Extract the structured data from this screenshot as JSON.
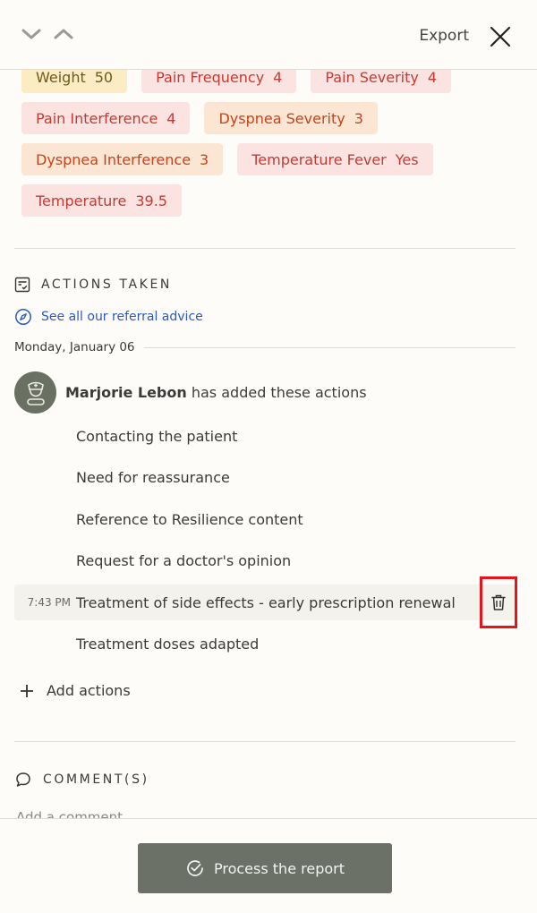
{
  "header": {
    "export_label": "Export"
  },
  "tags": [
    {
      "name": "Weight",
      "value": "50",
      "tone": "yellow"
    },
    {
      "name": "Pain Frequency",
      "value": "4",
      "tone": "pink"
    },
    {
      "name": "Pain Severity",
      "value": "4",
      "tone": "pink"
    },
    {
      "name": "Pain Interference",
      "value": "4",
      "tone": "pink"
    },
    {
      "name": "Dyspnea Severity",
      "value": "3",
      "tone": "peach"
    },
    {
      "name": "Dyspnea Interference",
      "value": "3",
      "tone": "peach"
    },
    {
      "name": "Temperature Fever",
      "value": "Yes",
      "tone": "pink"
    },
    {
      "name": "Temperature",
      "value": "39.5",
      "tone": "pink"
    }
  ],
  "actions_section": {
    "title": "ACTIONS TAKEN",
    "referral_link": "See all our referral advice",
    "date": "Monday, January 06",
    "author_name": "Marjorie Lebon",
    "author_suffix": "has added these actions",
    "items": [
      {
        "label": "Contacting the patient",
        "time": ""
      },
      {
        "label": "Need for reassurance",
        "time": ""
      },
      {
        "label": "Reference to Resilience content",
        "time": ""
      },
      {
        "label": "Request for a doctor's opinion",
        "time": ""
      },
      {
        "label": "Treatment of side effects - early prescription renewal",
        "time": "7:43 PM"
      },
      {
        "label": "Treatment doses adapted",
        "time": ""
      }
    ],
    "add_label": "Add actions"
  },
  "comments_section": {
    "title": "COMMENT(S)",
    "placeholder": "Add a comment"
  },
  "footer": {
    "process_label": "Process the report"
  },
  "colors": {
    "accent_blue": "#2b59c3",
    "button_bg": "#6b7166",
    "highlight_box": "#e8141c"
  }
}
